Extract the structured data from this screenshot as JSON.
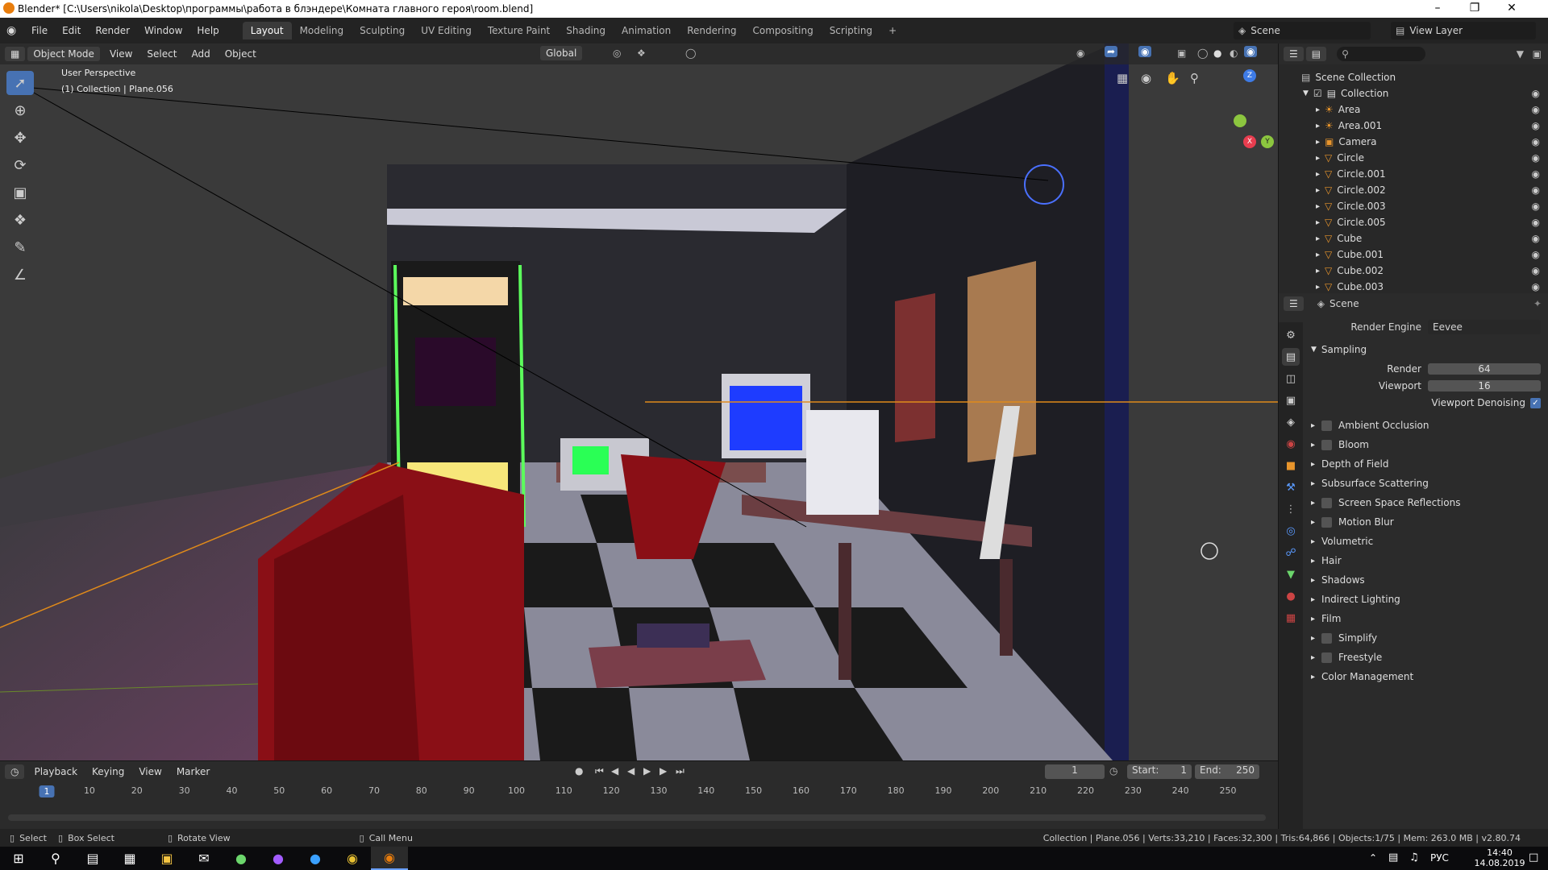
{
  "window": {
    "title": "Blender* [C:\\Users\\nikola\\Desktop\\программы\\работа в блэндере\\Комната главного героя\\room.blend]",
    "min_icon": "minimize-icon",
    "max_icon": "maximize-icon",
    "close_icon": "close-icon"
  },
  "menu": {
    "items": [
      "File",
      "Edit",
      "Render",
      "Window",
      "Help"
    ],
    "workspaces": [
      "Layout",
      "Modeling",
      "Sculpting",
      "UV Editing",
      "Texture Paint",
      "Shading",
      "Animation",
      "Rendering",
      "Compositing",
      "Scripting"
    ],
    "add_tab": "+",
    "scene_label": "Scene",
    "view_layer_label": "View Layer"
  },
  "viewport": {
    "mode": "Object Mode",
    "menus": [
      "View",
      "Select",
      "Add",
      "Object"
    ],
    "orientation": "Global",
    "overlay_title": "User Perspective",
    "overlay_subtitle": "(1) Collection | Plane.056",
    "gizmo": {
      "x": "X",
      "y": "Y",
      "z": "Z"
    }
  },
  "outliner": {
    "root": "Scene Collection",
    "collection": "Collection",
    "items": [
      {
        "name": "Area",
        "icon": "light-icon"
      },
      {
        "name": "Area.001",
        "icon": "light-icon"
      },
      {
        "name": "Camera",
        "icon": "camera-icon"
      },
      {
        "name": "Circle",
        "icon": "mesh-icon"
      },
      {
        "name": "Circle.001",
        "icon": "mesh-icon"
      },
      {
        "name": "Circle.002",
        "icon": "mesh-icon"
      },
      {
        "name": "Circle.003",
        "icon": "mesh-icon"
      },
      {
        "name": "Circle.005",
        "icon": "mesh-icon"
      },
      {
        "name": "Cube",
        "icon": "mesh-icon"
      },
      {
        "name": "Cube.001",
        "icon": "mesh-icon"
      },
      {
        "name": "Cube.002",
        "icon": "mesh-icon"
      },
      {
        "name": "Cube.003",
        "icon": "mesh-icon"
      }
    ]
  },
  "properties": {
    "context": "Scene",
    "render_engine_label": "Render Engine",
    "render_engine": "Eevee",
    "sampling": {
      "title": "Sampling",
      "render_label": "Render",
      "render": "64",
      "viewport_label": "Viewport",
      "viewport": "16",
      "denoise_label": "Viewport Denoising"
    },
    "panels": [
      {
        "label": "Ambient Occlusion",
        "checkbox": true
      },
      {
        "label": "Bloom",
        "checkbox": true
      },
      {
        "label": "Depth of Field",
        "checkbox": false
      },
      {
        "label": "Subsurface Scattering",
        "checkbox": false
      },
      {
        "label": "Screen Space Reflections",
        "checkbox": true
      },
      {
        "label": "Motion Blur",
        "checkbox": true
      },
      {
        "label": "Volumetric",
        "checkbox": false
      },
      {
        "label": "Hair",
        "checkbox": false
      },
      {
        "label": "Shadows",
        "checkbox": false
      },
      {
        "label": "Indirect Lighting",
        "checkbox": false
      },
      {
        "label": "Film",
        "checkbox": false
      },
      {
        "label": "Simplify",
        "checkbox": true
      },
      {
        "label": "Freestyle",
        "checkbox": true
      },
      {
        "label": "Color Management",
        "checkbox": false
      }
    ]
  },
  "timeline": {
    "menus": [
      "Playback",
      "Keying",
      "View",
      "Marker"
    ],
    "current_frame": "1",
    "start_label": "Start:",
    "start": "1",
    "end_label": "End:",
    "end": "250",
    "ticks": [
      "1",
      "10",
      "20",
      "30",
      "40",
      "50",
      "60",
      "70",
      "80",
      "90",
      "100",
      "110",
      "120",
      "130",
      "140",
      "150",
      "160",
      "170",
      "180",
      "190",
      "200",
      "210",
      "220",
      "230",
      "240",
      "250"
    ]
  },
  "status": {
    "select": "Select",
    "box_select": "Box Select",
    "rotate": "Rotate View",
    "call_menu": "Call Menu",
    "stats": "Collection | Plane.056 | Verts:33,210 | Faces:32,300 | Tris:64,866 | Objects:1/75 | Mem: 263.0 MB | v2.80.74"
  },
  "taskbar": {
    "lang": "РУС",
    "time": "14:40",
    "date": "14.08.2019"
  },
  "colors": {
    "accent": "#4772b3",
    "selection": "#ff8c1a"
  }
}
